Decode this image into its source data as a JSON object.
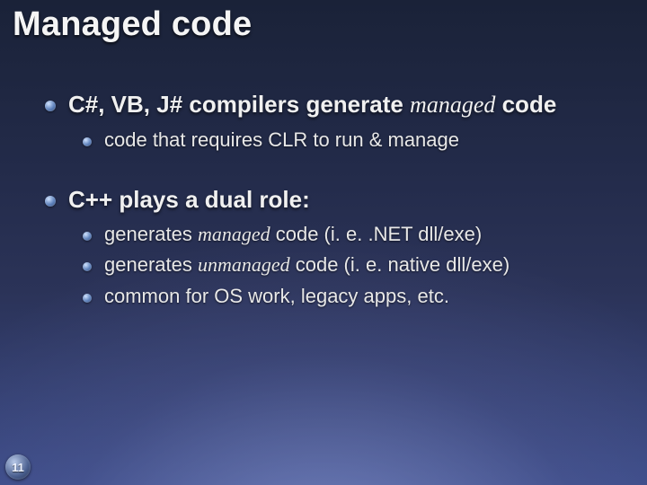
{
  "title": "Managed code",
  "bullets": {
    "b1_pre": "C#, VB, J# compilers generate ",
    "b1_em": "managed",
    "b1_post": " code",
    "b1a": "code that requires CLR to run & manage",
    "b2": "C++ plays a dual role:",
    "b2a_pre": "generates ",
    "b2a_em": "managed",
    "b2a_post": " code (i. e. .NET dll/exe)",
    "b2b_pre": "generates ",
    "b2b_em": "unmanaged",
    "b2b_post": " code (i. e. native dll/exe)",
    "b2c": "common for OS work, legacy apps, etc."
  },
  "page_number": "11"
}
